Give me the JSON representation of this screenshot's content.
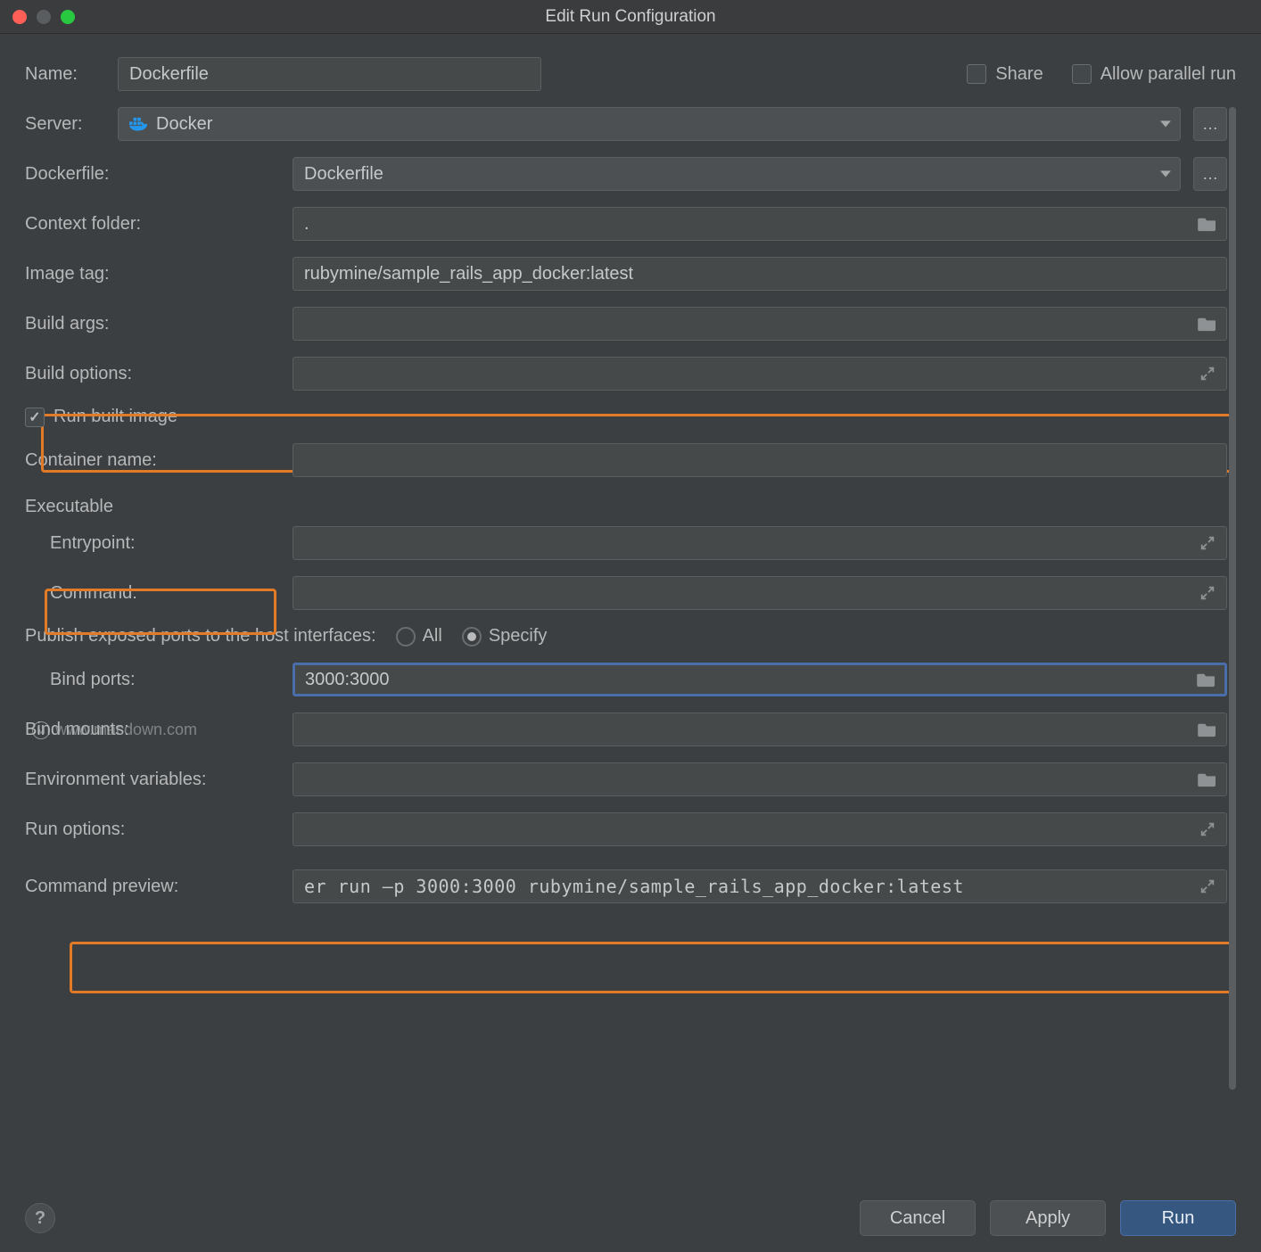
{
  "window": {
    "title": "Edit Run Configuration"
  },
  "header": {
    "name_label": "Name:",
    "name_value": "Dockerfile",
    "share_label": "Share",
    "allow_parallel_label": "Allow parallel run",
    "share_checked": false,
    "allow_parallel_checked": false
  },
  "fields": {
    "server_label": "Server:",
    "server_value": "Docker",
    "dockerfile_label": "Dockerfile:",
    "dockerfile_value": "Dockerfile",
    "context_folder_label": "Context folder:",
    "context_folder_value": ".",
    "image_tag_label": "Image tag:",
    "image_tag_value": "rubymine/sample_rails_app_docker:latest",
    "build_args_label": "Build args:",
    "build_args_value": "",
    "build_options_label": "Build options:",
    "build_options_value": "",
    "run_built_image_label": "Run built image",
    "run_built_image_checked": true,
    "container_name_label": "Container name:",
    "container_name_value": "",
    "executable_section": "Executable",
    "entrypoint_label": "Entrypoint:",
    "entrypoint_value": "",
    "command_label": "Command:",
    "command_value": "",
    "publish_ports_label": "Publish exposed ports to the host interfaces:",
    "ports_all_label": "All",
    "ports_specify_label": "Specify",
    "ports_mode": "specify",
    "bind_ports_label": "Bind ports:",
    "bind_ports_value": "3000:3000",
    "bind_mounts_label": "Bind mounts:",
    "bind_mounts_value": "",
    "env_vars_label": "Environment variables:",
    "env_vars_value": "",
    "run_options_label": "Run options:",
    "run_options_value": "",
    "command_preview_label": "Command preview:",
    "command_preview_value": "er run –p 3000:3000 rubymine/sample_rails_app_docker:latest"
  },
  "buttons": {
    "cancel": "Cancel",
    "apply": "Apply",
    "run": "Run"
  },
  "colors": {
    "highlight": "#e27a26",
    "primary": "#365880",
    "focus_border": "#4a6ea9",
    "bg": "#3c3f41",
    "input_bg": "#45494a"
  },
  "watermark": "www.macdown.com"
}
